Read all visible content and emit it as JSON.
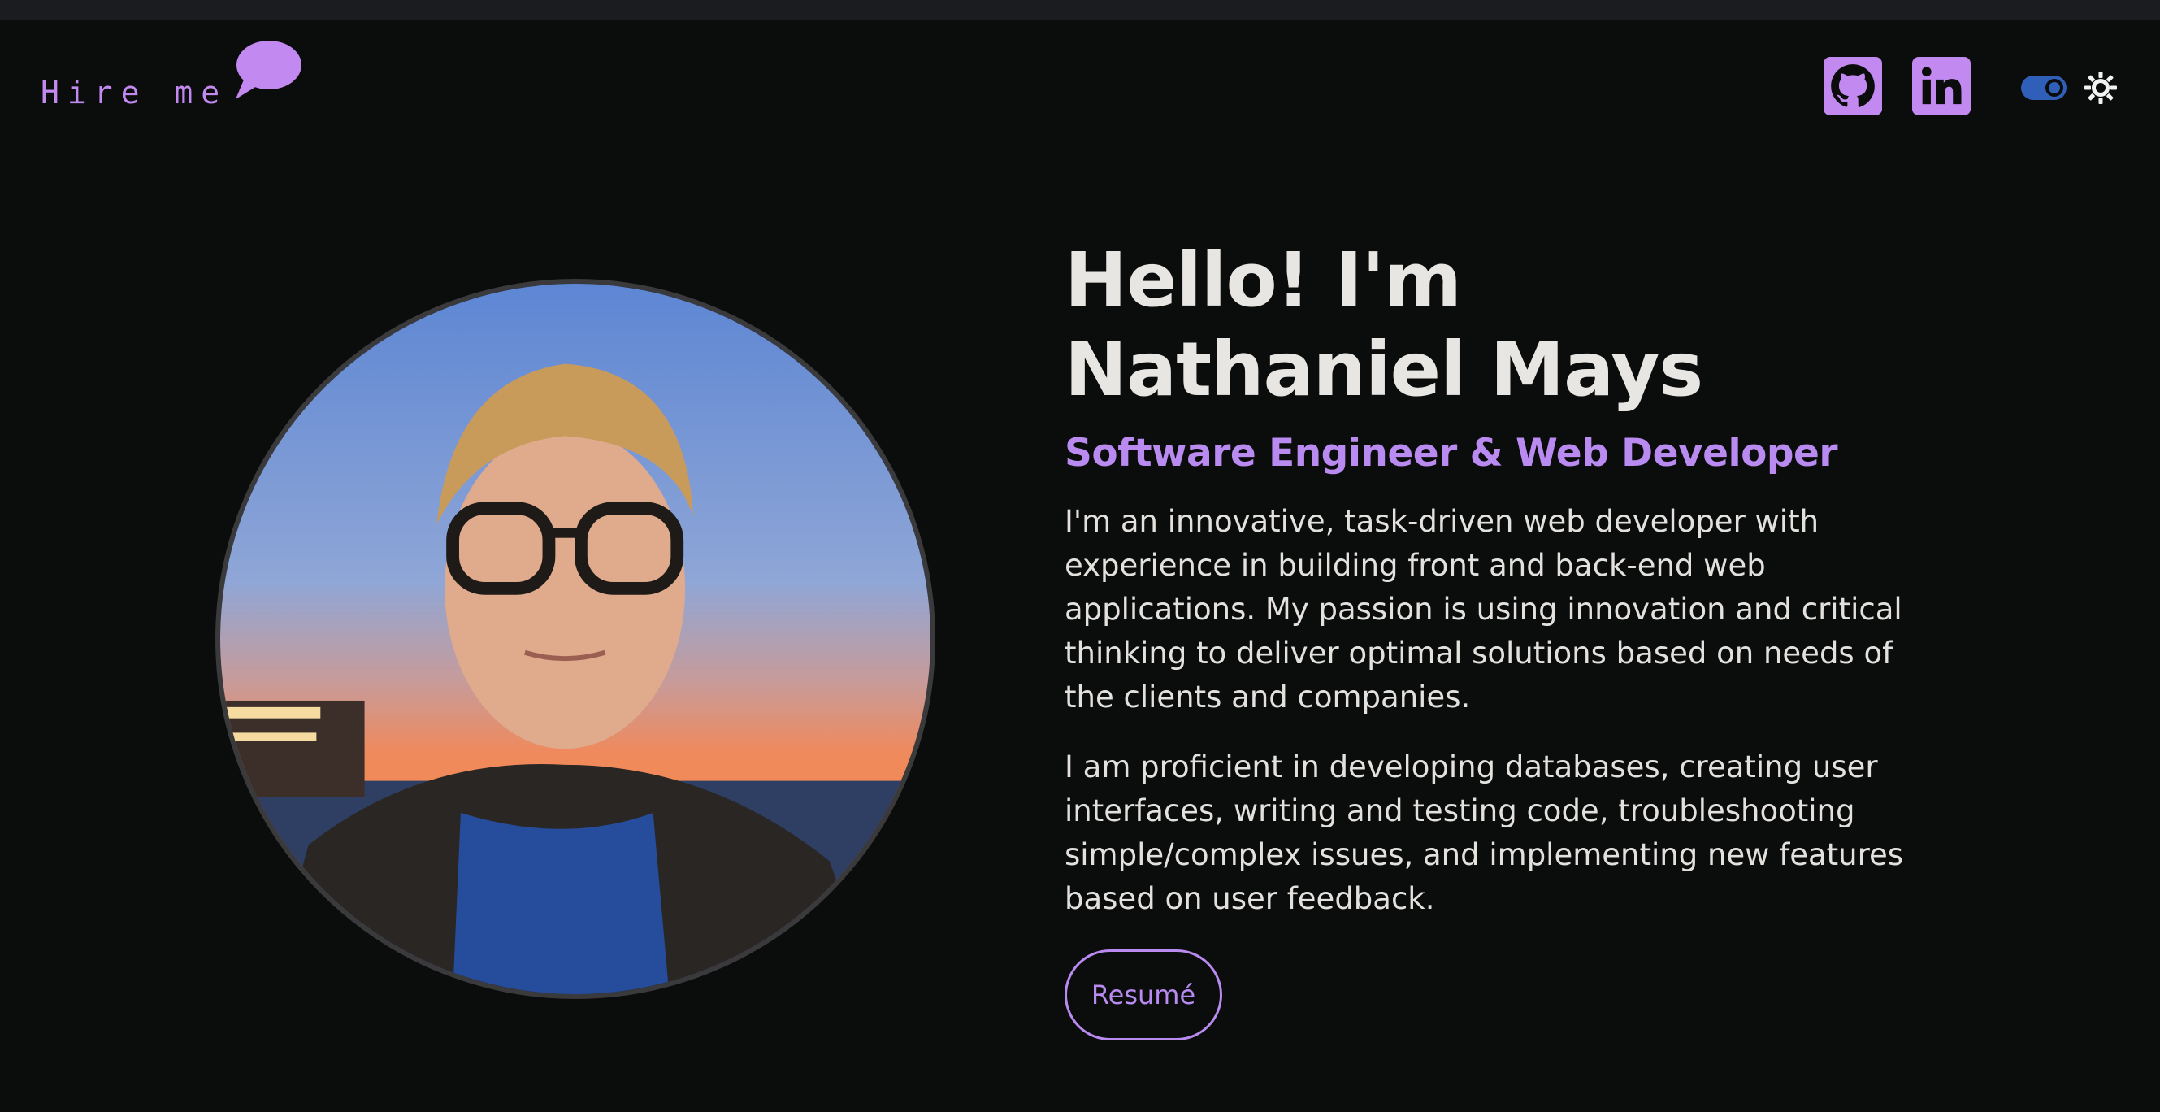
{
  "header": {
    "hire_label": "Hire me",
    "github_label": "GitHub",
    "linkedin_label": "LinkedIn"
  },
  "hero": {
    "greeting": "Hello! I'm",
    "name": "Nathaniel Mays",
    "role": "Software Engineer & Web Developer",
    "paragraphs": [
      "I'm an innovative, task-driven web developer with experience in building front and back-end web applications. My passion is using innovation and critical thinking to deliver optimal solutions based on needs of the clients and companies.",
      "I am proficient in developing databases, creating user interfaces, writing and testing code, troubleshooting simple/complex issues, and implementing new features based on user feedback."
    ],
    "resume_label": "Resumé"
  },
  "colors": {
    "background": "#0b0c0c",
    "accent": "#c289f0",
    "text": "#e8e6e3",
    "toggle": "#2f5fb8"
  },
  "icons": [
    "chat-bubble-icon",
    "github-icon",
    "linkedin-icon",
    "theme-toggle",
    "sun-icon"
  ]
}
